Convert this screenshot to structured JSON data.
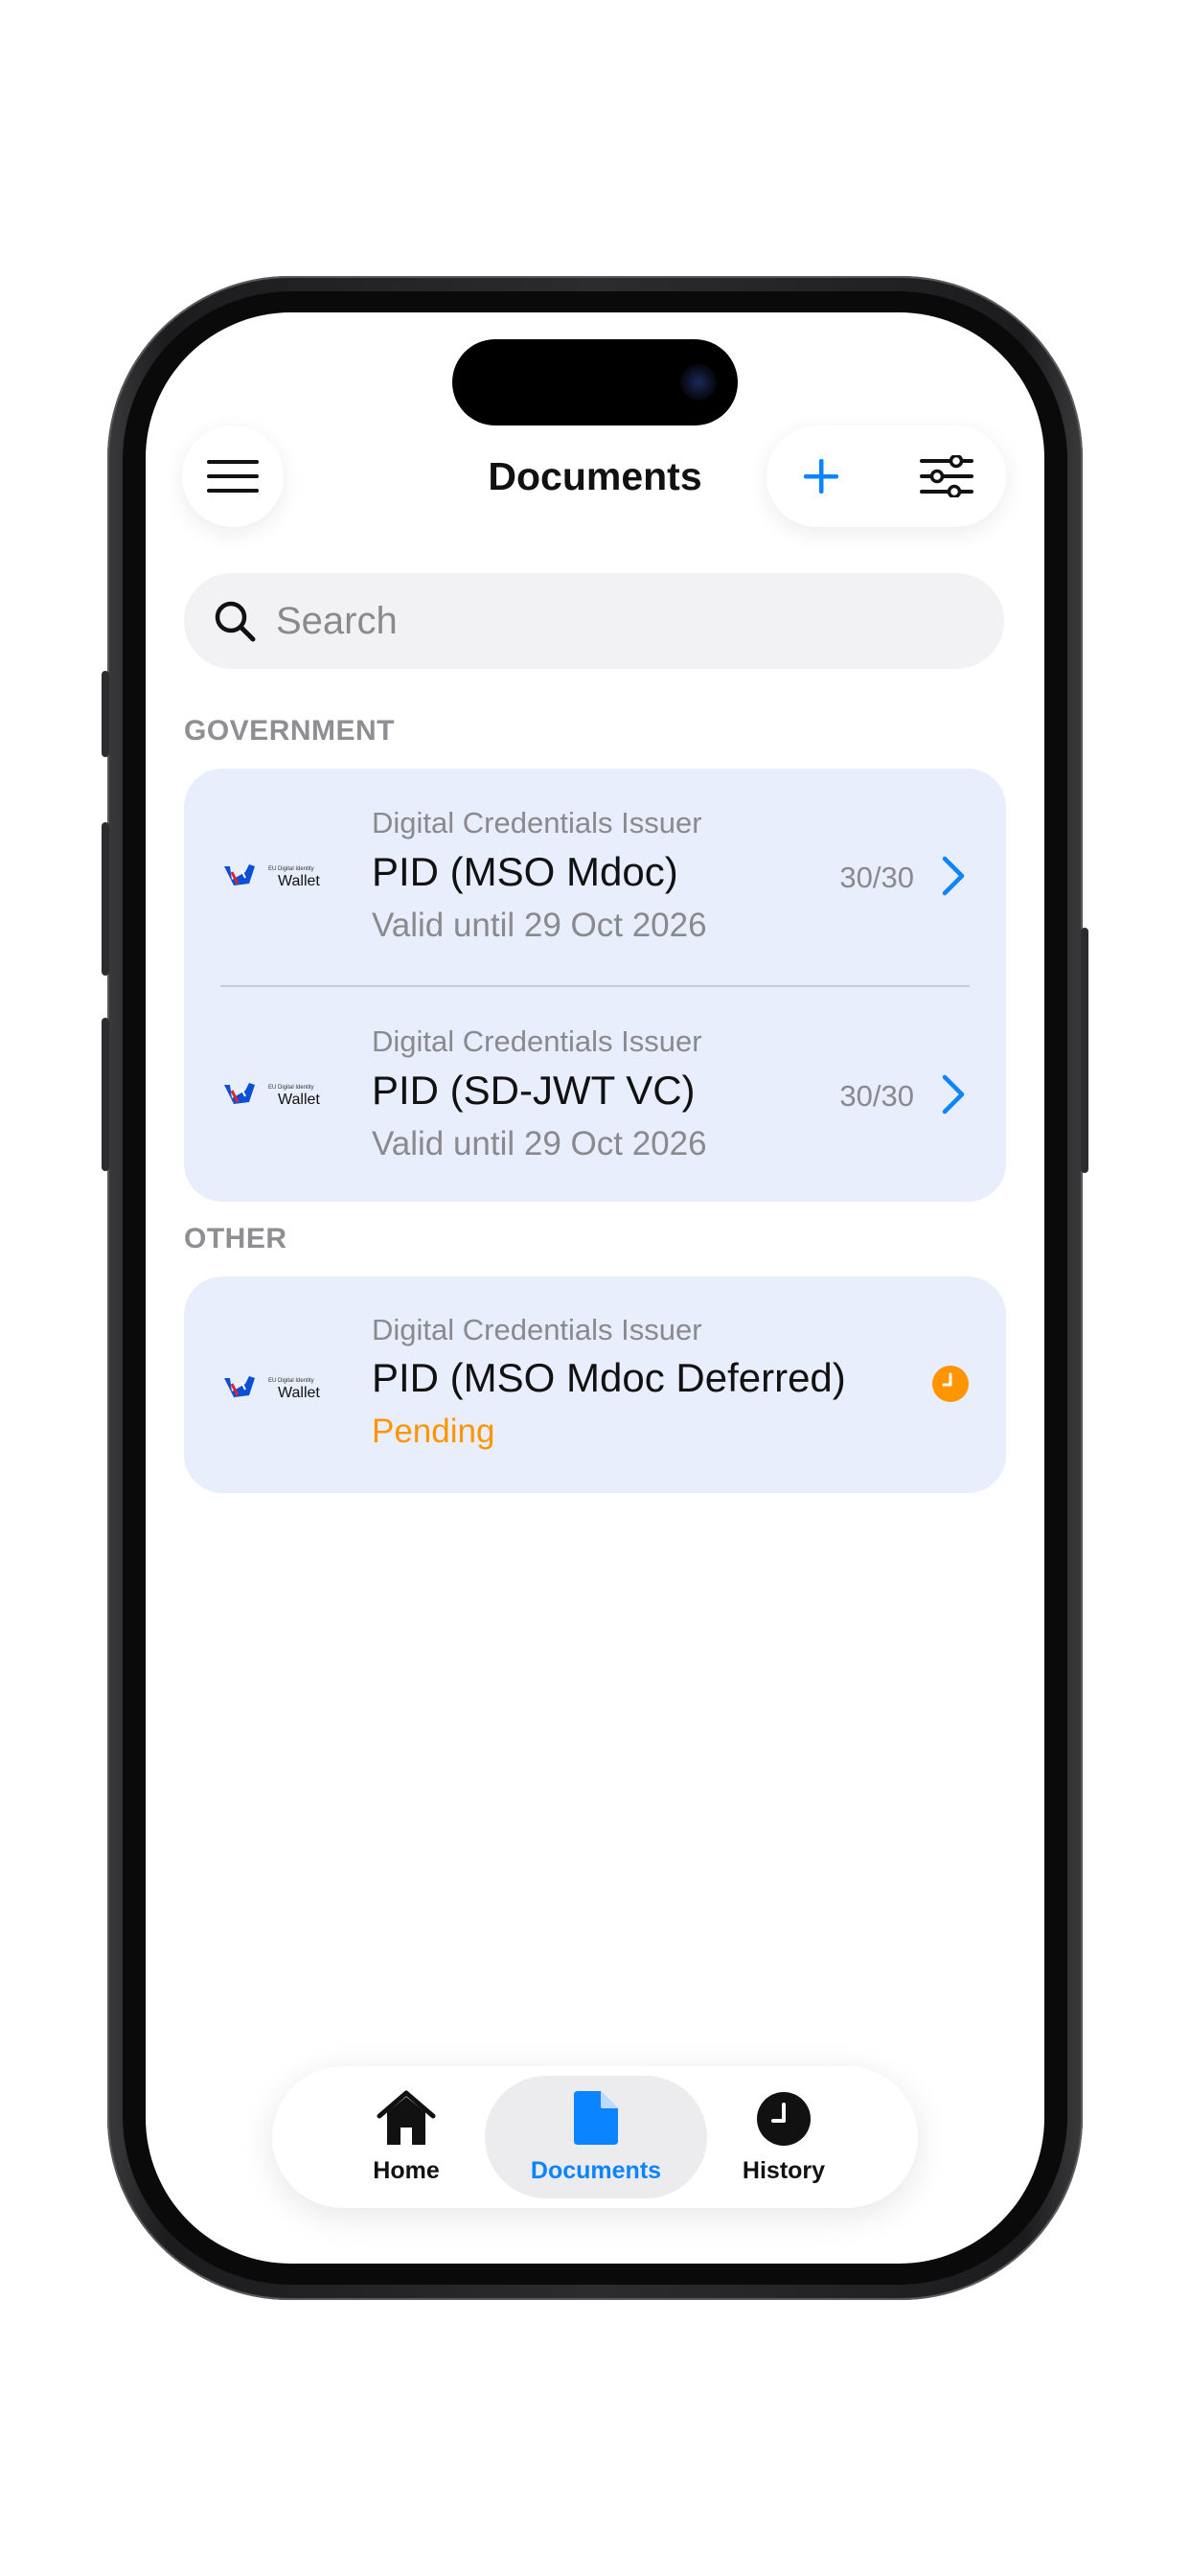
{
  "header": {
    "title": "Documents"
  },
  "search": {
    "placeholder": "Search"
  },
  "sections": [
    {
      "label": "GOVERNMENT",
      "items": [
        {
          "issuer": "Digital Credentials Issuer",
          "name": "PID (MSO Mdoc)",
          "status": "Valid until 29 Oct 2026",
          "count": "30/30"
        },
        {
          "issuer": "Digital Credentials Issuer",
          "name": "PID (SD-JWT VC)",
          "status": "Valid until 29 Oct 2026",
          "count": "30/30"
        }
      ]
    },
    {
      "label": "OTHER",
      "items": [
        {
          "issuer": "Digital Credentials Issuer",
          "name": "PID (MSO Mdoc Deferred)",
          "status": "Pending"
        }
      ]
    }
  ],
  "logo": {
    "small_text": "EU Digital Identity",
    "brand": "Wallet"
  },
  "tabbar": {
    "tabs": [
      {
        "label": "Home",
        "icon": "house-icon",
        "active": false
      },
      {
        "label": "Documents",
        "icon": "document-icon",
        "active": true
      },
      {
        "label": "History",
        "icon": "clock-icon",
        "active": false
      }
    ]
  },
  "colors": {
    "accent": "#0a84ff",
    "card": "#e8eefc",
    "pending": "#ff9500",
    "secondary_text": "#8a8a8e"
  }
}
